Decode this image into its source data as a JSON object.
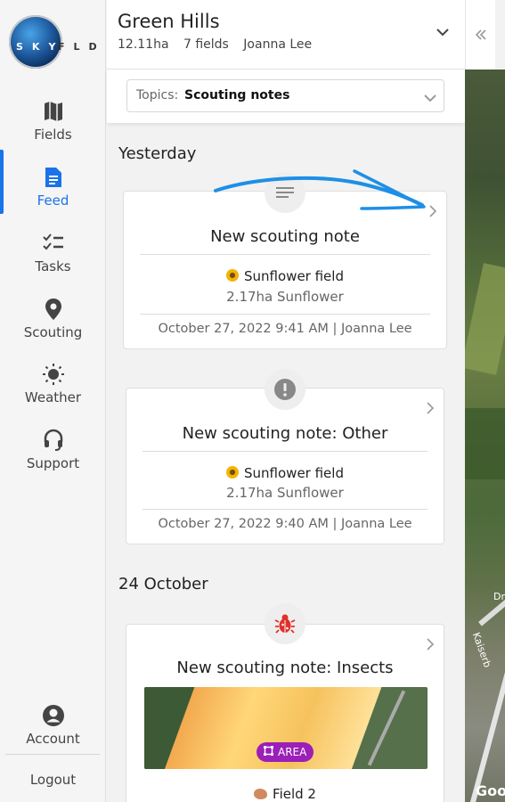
{
  "sidebar": {
    "logo_text": "SKY",
    "logo_text2": "FLD",
    "items": [
      {
        "label": "Fields",
        "icon": "map-icon"
      },
      {
        "label": "Feed",
        "icon": "document-icon"
      },
      {
        "label": "Tasks",
        "icon": "checklist-icon"
      },
      {
        "label": "Scouting",
        "icon": "location-pin-icon"
      },
      {
        "label": "Weather",
        "icon": "sun-icon"
      },
      {
        "label": "Support",
        "icon": "headset-icon"
      }
    ],
    "active_item": "Feed",
    "account_label": "Account",
    "logout_label": "Logout"
  },
  "header": {
    "farm_name": "Green Hills",
    "area": "12.11ha",
    "fields": "7 fields",
    "owner": "Joanna Lee"
  },
  "topics": {
    "label": "Topics:",
    "value": "Scouting notes"
  },
  "feed": {
    "sections": [
      {
        "title": "Yesterday",
        "cards": [
          {
            "title": "New scouting note",
            "field": "Sunflower field",
            "crop": "2.17ha Sunflower",
            "meta": "October 27, 2022 9:41 AM | Joanna Lee",
            "icon": "note-lines-icon"
          },
          {
            "title": "New scouting note: Other",
            "field": "Sunflower field",
            "crop": "2.17ha Sunflower",
            "meta": "October 27, 2022 9:40 AM | Joanna Lee",
            "icon": "exclamation-icon"
          }
        ]
      },
      {
        "title": "24 October",
        "cards": [
          {
            "title": "New scouting note: Insects",
            "area_label": "AREA",
            "field": "Field 2",
            "icon": "bug-icon"
          }
        ]
      }
    ]
  },
  "map": {
    "label1": "Dr",
    "label2": "Kaiserb",
    "label3": "Goo"
  },
  "colors": {
    "accent": "#1a73e8",
    "area_pill": "#9b1fb8",
    "bug_red": "#e0302a",
    "annotation_arrow": "#1e8fe6"
  }
}
